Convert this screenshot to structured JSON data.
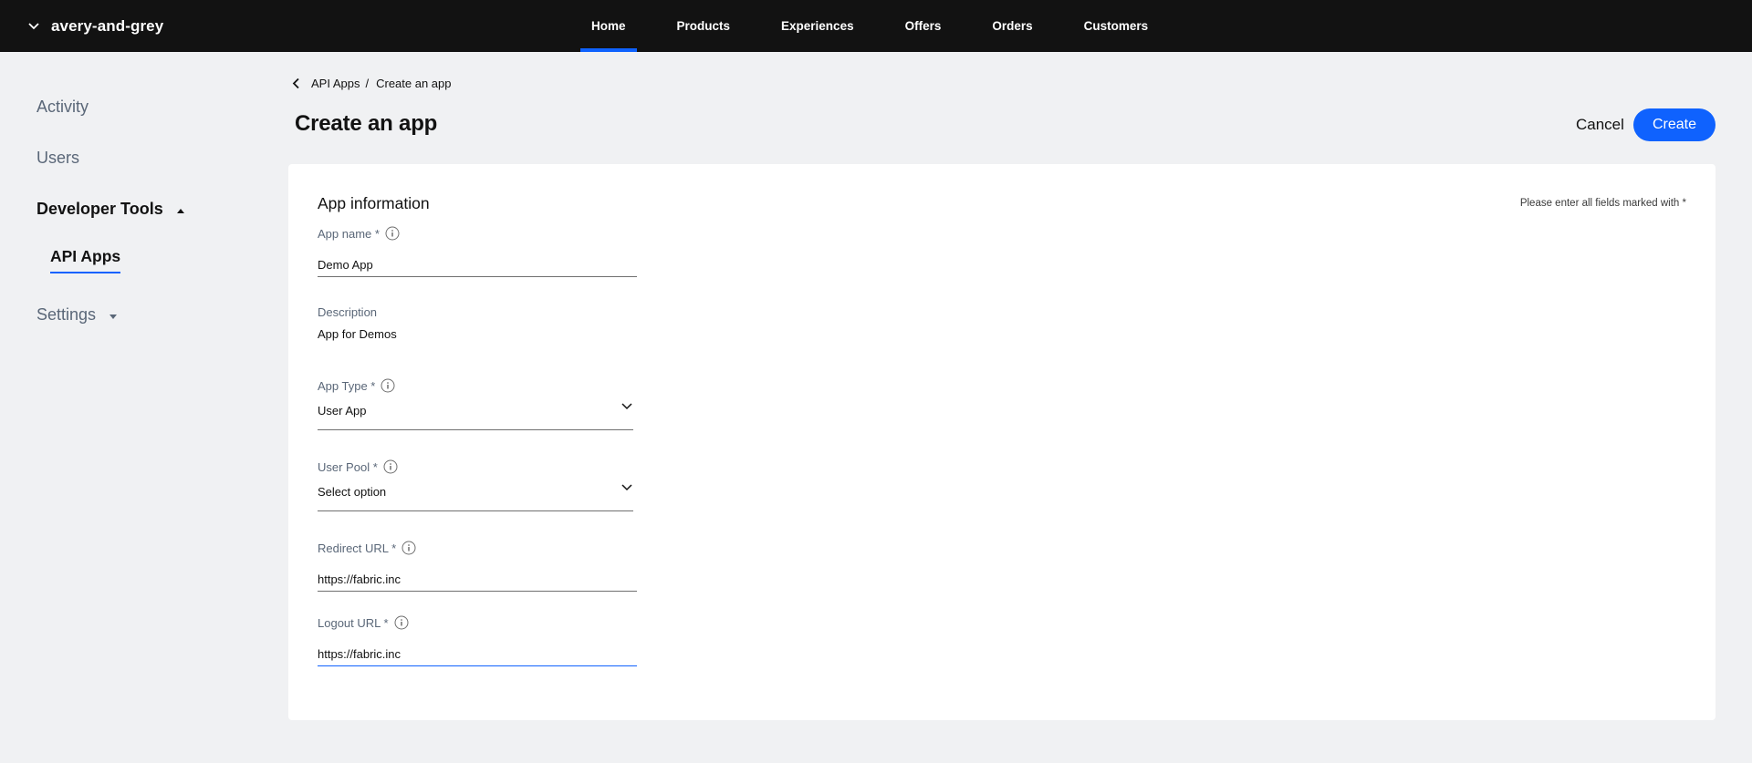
{
  "topbar": {
    "org_name": "avery-and-grey",
    "nav": [
      {
        "label": "Home",
        "active": true
      },
      {
        "label": "Products"
      },
      {
        "label": "Experiences"
      },
      {
        "label": "Offers"
      },
      {
        "label": "Orders"
      },
      {
        "label": "Customers"
      }
    ]
  },
  "sidebar": {
    "activity": "Activity",
    "users": "Users",
    "developer_tools": "Developer Tools",
    "api_apps": "API Apps",
    "settings": "Settings"
  },
  "breadcrumb": {
    "parent": "API Apps",
    "separator": "/",
    "current": "Create an app"
  },
  "page": {
    "title": "Create an app",
    "cancel_label": "Cancel",
    "create_label": "Create"
  },
  "form": {
    "section_title": "App information",
    "required_note": "Please enter all fields marked with *",
    "app_name": {
      "label": "App name *",
      "value": "Demo App"
    },
    "description": {
      "label": "Description",
      "value": "App for Demos"
    },
    "app_type": {
      "label": "App Type *",
      "value": "User App"
    },
    "user_pool": {
      "label": "User Pool *",
      "value": "Select option"
    },
    "redirect_url": {
      "label": "Redirect URL *",
      "value": "https://fabric.inc"
    },
    "logout_url": {
      "label": "Logout URL *",
      "value": "https://fabric.inc"
    }
  },
  "colors": {
    "accent": "#0f62fe",
    "topbar": "#121212",
    "background": "#f0f1f3",
    "muted_text": "#5a6778"
  }
}
